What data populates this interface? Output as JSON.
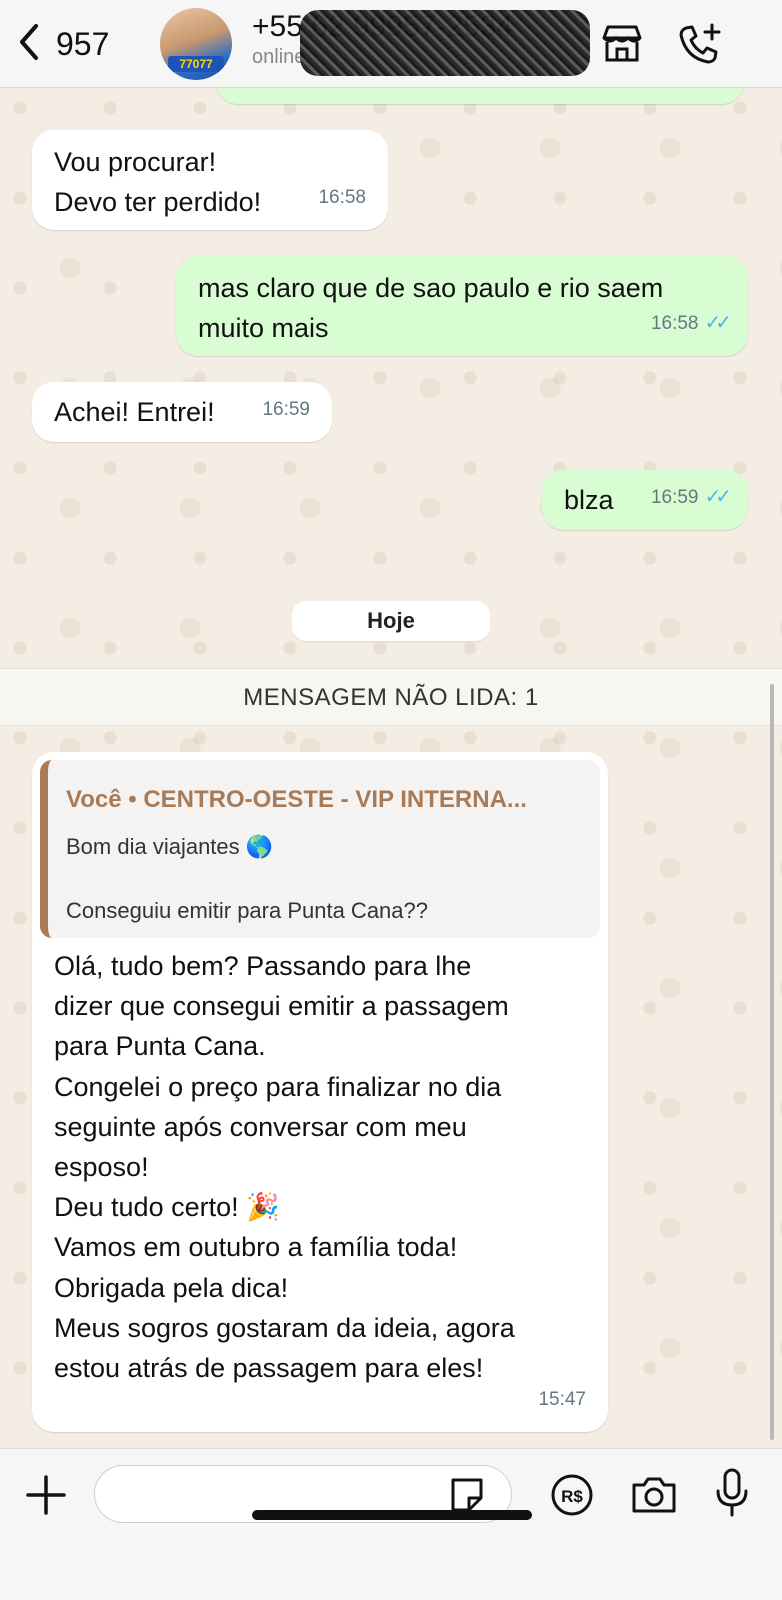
{
  "header": {
    "back_count": "957",
    "contact_name": "+55 62 99957-2534",
    "contact_status": "online",
    "avatar_badge": "77077"
  },
  "messages": [
    {
      "dir": "in",
      "text": "Vou procurar!\nDevo ter perdido!",
      "time": "16:58"
    },
    {
      "dir": "out",
      "text": "mas claro que de sao paulo e rio saem muito mais",
      "time": "16:58",
      "status": "read"
    },
    {
      "dir": "in",
      "text": "Achei! Entrei!",
      "time": "16:59"
    },
    {
      "dir": "out",
      "text": "blza",
      "time": "16:59",
      "status": "read"
    }
  ],
  "day_separator": "Hoje",
  "unread_label": "MENSAGEM NÃO LIDA: 1",
  "last_message": {
    "quote_author": "Você • CENTRO-OESTE - VIP INTERNA...",
    "quote_line1": "Bom dia viajantes 🌎",
    "quote_line2": "Conseguiu emitir para Punta Cana??",
    "text": "Olá, tudo bem? Passando para lhe\ndizer que consegui emitir a passagem\npara Punta Cana.\nCongelei o preço para finalizar no dia\nseguinte após conversar com meu\nesposo!\nDeu tudo certo! 🎉\nVamos em outubro a família toda!\nObrigada pela dica!\nMeus sogros gostaram da ideia, agora\nestou atrás de passagem para eles!",
    "time": "15:47"
  },
  "input": {
    "placeholder": ""
  },
  "colors": {
    "outgoing": "#d9fdd3",
    "incoming": "#ffffff",
    "accent_read": "#4fb6ec",
    "quote_accent": "#a87b56"
  },
  "icons": [
    "chevron-left-icon",
    "storefront-icon",
    "phone-add-icon",
    "plus-icon",
    "sticker-icon",
    "payment-icon",
    "camera-icon",
    "microphone-icon"
  ]
}
